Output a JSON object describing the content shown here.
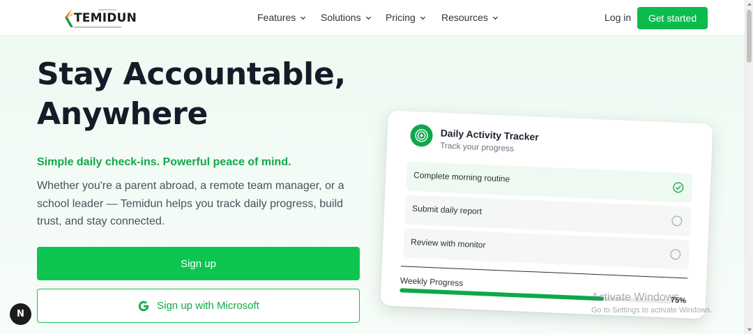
{
  "nav": {
    "brand": "TEMIDUN",
    "items": [
      {
        "label": "Features"
      },
      {
        "label": "Solutions"
      },
      {
        "label": "Pricing"
      },
      {
        "label": "Resources"
      }
    ],
    "login_label": "Log in",
    "cta_label": "Get started"
  },
  "hero": {
    "title_line1": "Stay Accountable,",
    "title_line2": "Anywhere",
    "tagline": "Simple daily check-ins. Powerful peace of mind.",
    "description": "Whether you're a parent abroad, a remote team manager, or a school leader — Temidun helps you track daily progress, build trust, and stay connected.",
    "signup_label": "Sign up",
    "signup_microsoft_label": "Sign up with Microsoft"
  },
  "badge": {
    "label": "N"
  },
  "tracker": {
    "title": "Daily Activity Tracker",
    "subtitle": "Track your progress",
    "tasks": [
      {
        "label": "Complete morning routine",
        "done": true
      },
      {
        "label": "Submit daily report",
        "done": false
      },
      {
        "label": "Review with monitor",
        "done": false
      }
    ],
    "progress_label": "Weekly Progress",
    "progress_value": 0.75,
    "progress_text": "75%"
  },
  "watermark": {
    "line1": "Activate Windows",
    "line2": "Go to Settings to activate Windows."
  },
  "colors": {
    "accent": "#0ec451",
    "accent_dark": "#0ea84b",
    "heading": "#151b27",
    "tagline": "#12a84a"
  },
  "icons": {
    "logo": "temidun-logo-icon",
    "dropdown": "chevron-down-icon",
    "tracker": "target-icon",
    "task_done": "check-circle-icon",
    "task_pending": "empty-circle-icon",
    "microsoft": "g-logo-icon"
  }
}
